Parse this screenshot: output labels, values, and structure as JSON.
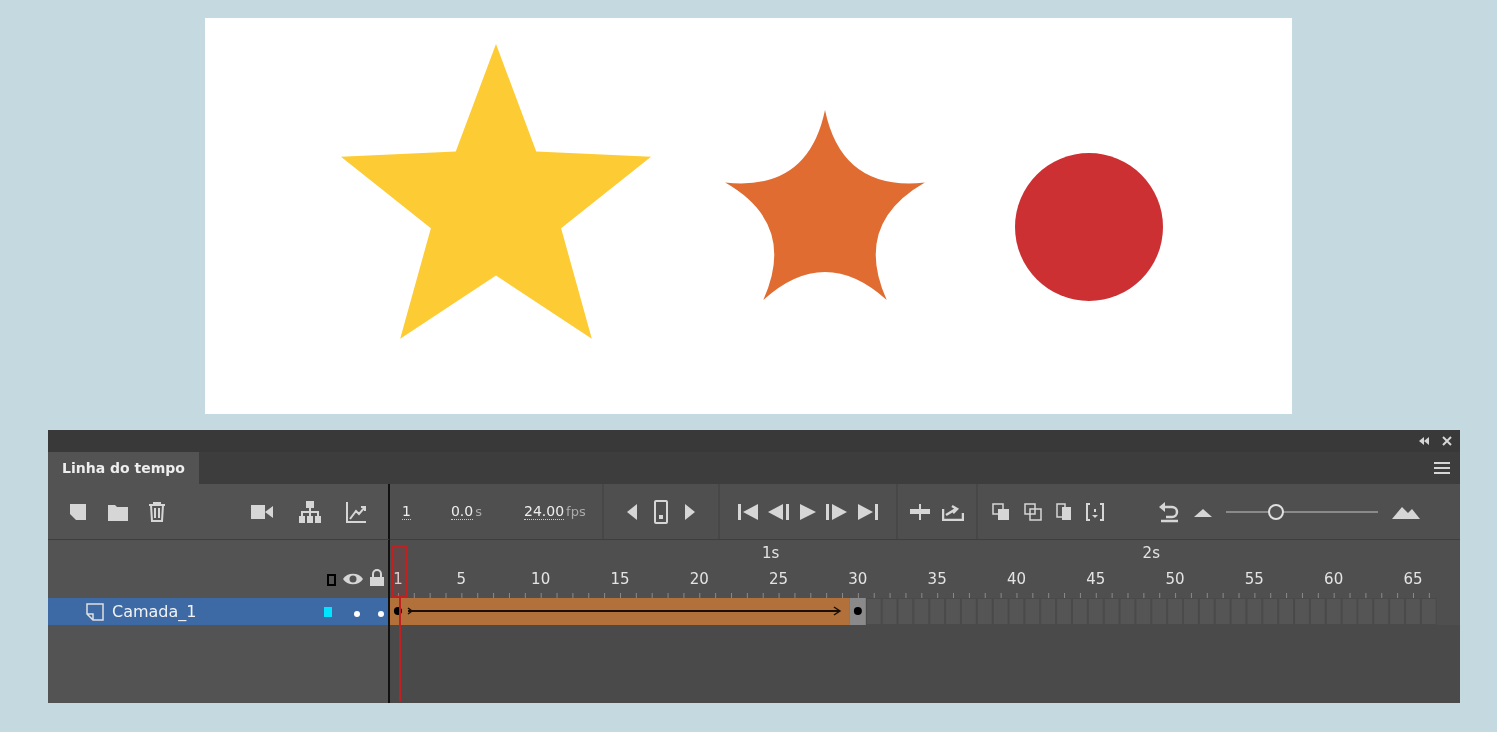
{
  "stage": {
    "shapes": [
      {
        "kind": "star",
        "color": "#fdcb33"
      },
      {
        "kind": "rounded-star",
        "color": "#e06c32"
      },
      {
        "kind": "circle",
        "color": "#cc3033"
      }
    ]
  },
  "timeline": {
    "tabs": [
      {
        "label": "Linha do tempo",
        "selected": true
      }
    ],
    "current_frame": "1",
    "time": "0.0",
    "time_unit": "s",
    "frame_rate": "24.00",
    "frame_rate_unit": "fps",
    "zoom_slider": {
      "level": 0.33
    },
    "ruler": {
      "seconds": [
        "1s",
        "2s"
      ],
      "frames": [
        "1",
        "5",
        "10",
        "15",
        "20",
        "25",
        "30",
        "35",
        "40",
        "45",
        "50",
        "55",
        "60",
        "65"
      ]
    },
    "layers": [
      {
        "name": "Camada_1",
        "selected": true,
        "hidden": false,
        "locked": false
      }
    ]
  }
}
